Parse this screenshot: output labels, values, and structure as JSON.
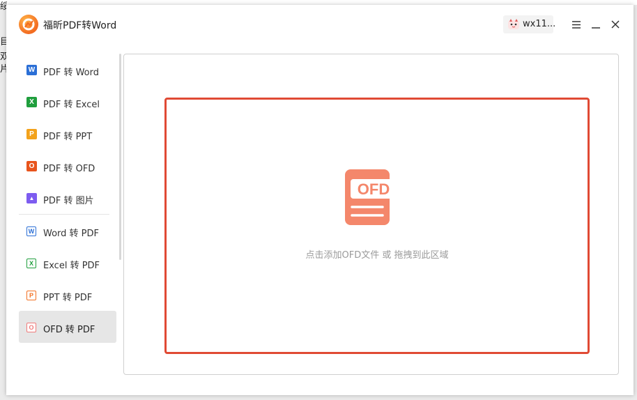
{
  "window": {
    "title": "福昕PDF转Word",
    "username": "wx11..."
  },
  "background_fragments": [
    "绥",
    "目",
    "双",
    "片"
  ],
  "sidebar": {
    "items": [
      {
        "label": "PDF 转 Word",
        "icon": "word-icon",
        "glyph": "W",
        "color": "#2b6fd6",
        "outline": false
      },
      {
        "label": "PDF 转 Excel",
        "icon": "excel-icon",
        "glyph": "X",
        "color": "#1f9e3d",
        "outline": false
      },
      {
        "label": "PDF 转 PPT",
        "icon": "ppt-icon",
        "glyph": "P",
        "color": "#f3a21b",
        "outline": false
      },
      {
        "label": "PDF 转 OFD",
        "icon": "ofd-icon",
        "glyph": "O",
        "color": "#e8541c",
        "outline": false
      },
      {
        "label": "PDF 转 图片",
        "icon": "image-icon",
        "glyph": "▲",
        "color": "#7d5cf0",
        "outline": false
      },
      {
        "label": "Word 转 PDF",
        "icon": "word-to-pdf-icon",
        "glyph": "W",
        "color": "#2b6fd6",
        "outline": true
      },
      {
        "label": "Excel 转 PDF",
        "icon": "excel-to-pdf-icon",
        "glyph": "X",
        "color": "#1f9e3d",
        "outline": true
      },
      {
        "label": "PPT 转 PDF",
        "icon": "ppt-to-pdf-icon",
        "glyph": "P",
        "color": "#f37021",
        "outline": true
      },
      {
        "label": "OFD 转 PDF",
        "icon": "ofd-to-pdf-icon",
        "glyph": "O",
        "color": "#f07a7a",
        "outline": true
      }
    ],
    "active_index": 8
  },
  "drop_zone": {
    "icon_text": "OFD",
    "hint": "点击添加OFD文件 或 拖拽到此区域",
    "border_color": "#e04a34"
  }
}
